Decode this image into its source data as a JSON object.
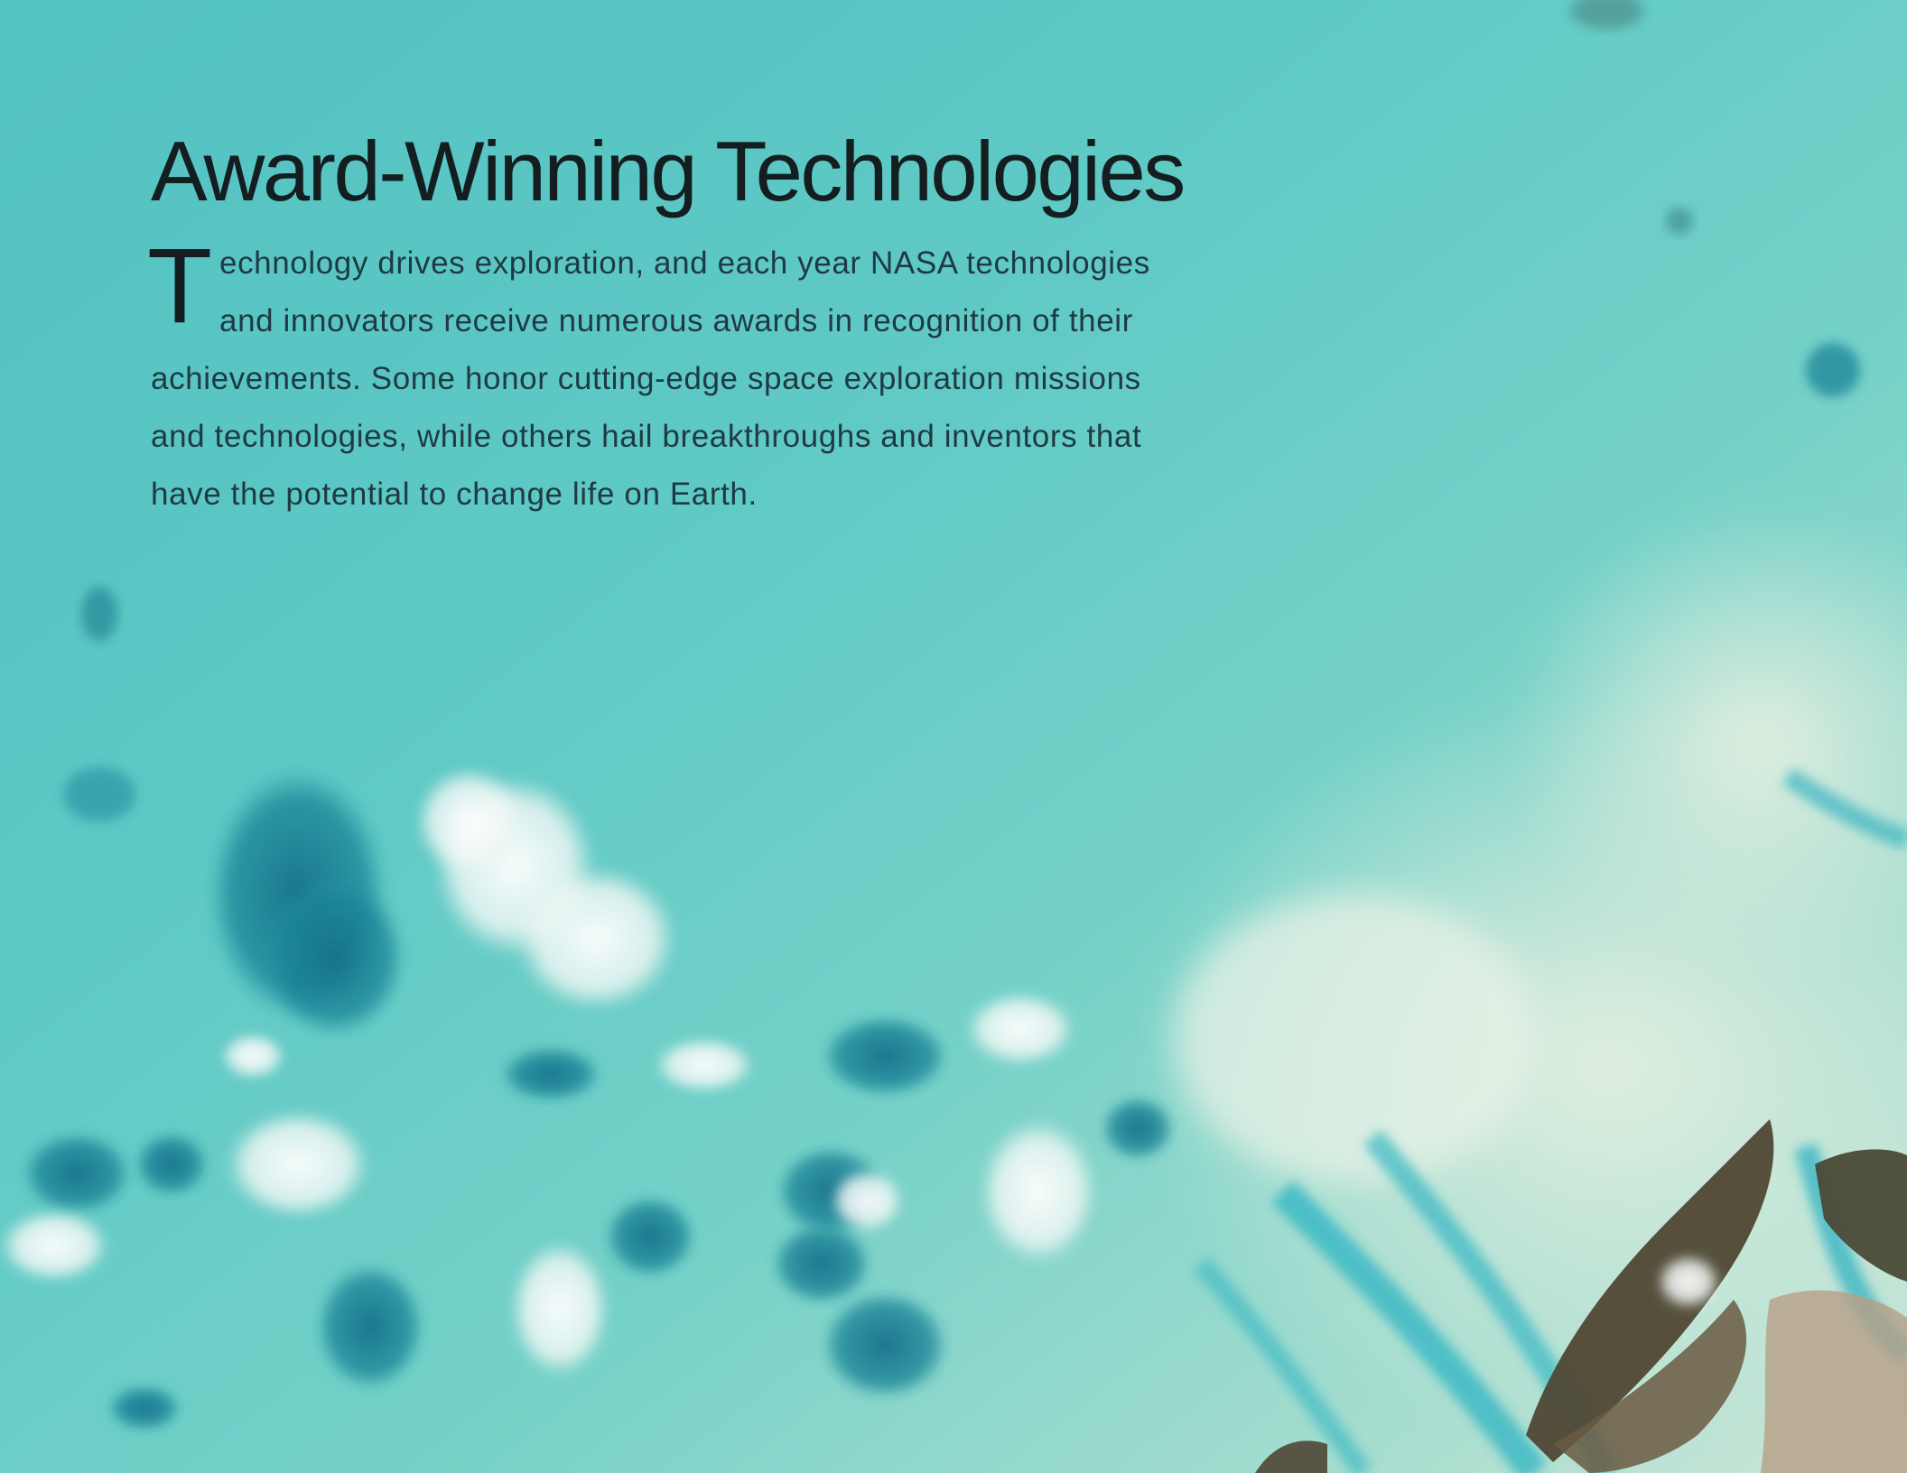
{
  "heading": {
    "title": "Award-Winning Technologies"
  },
  "intro": {
    "drop_cap": "T",
    "lines": [
      "echnology drives exploration, and each year NASA technologies",
      "and innovators receive numerous awards in recognition of their",
      "achievements. Some honor cutting-edge space exploration missions",
      "and technologies, while others hail breakthroughs and inventors that",
      "have the potential to change life on Earth."
    ]
  },
  "background": {
    "subject": "aerial-ocean-shallows-with-clouds",
    "colors": {
      "water": "#5cc6c2",
      "shallows": "#d6ecda",
      "cloud": "#f4f8f6",
      "cloud_shadow": "#1e7d8e",
      "land": "#5a4a36",
      "text_dark": "#141d1f"
    }
  }
}
